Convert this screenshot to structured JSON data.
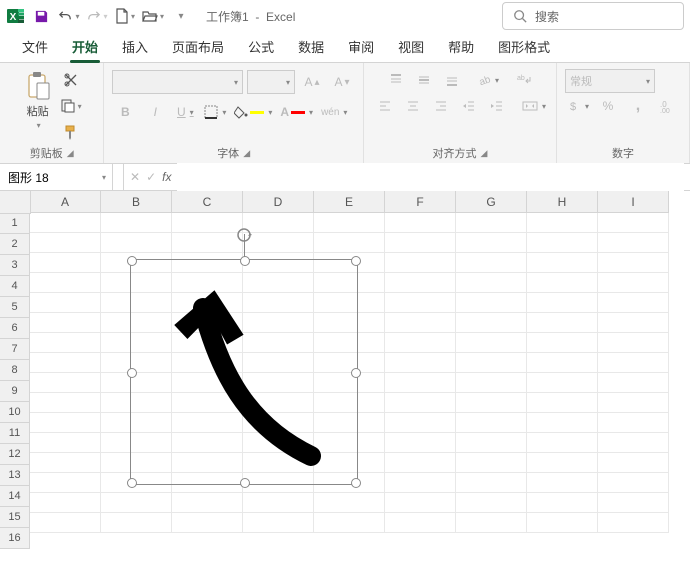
{
  "title": {
    "doc": "工作簿1",
    "app": "Excel"
  },
  "search": {
    "placeholder": "搜索"
  },
  "tabs": {
    "file": "文件",
    "home": "开始",
    "insert": "插入",
    "layout": "页面布局",
    "formulas": "公式",
    "data": "数据",
    "review": "审阅",
    "view": "视图",
    "help": "帮助",
    "shapeformat": "图形格式"
  },
  "ribbon": {
    "clipboard": {
      "label": "剪贴板",
      "paste": "粘贴"
    },
    "font": {
      "label": "字体",
      "bold": "B",
      "italic": "I",
      "underline": "U",
      "wen": "wén"
    },
    "align": {
      "label": "对齐方式"
    },
    "number": {
      "label": "数字",
      "general": "常规"
    }
  },
  "namebox": {
    "value": "图形 18"
  },
  "formula": {
    "value": ""
  },
  "cols": [
    "A",
    "B",
    "C",
    "D",
    "E",
    "F",
    "G",
    "H",
    "I"
  ],
  "rows": [
    "1",
    "2",
    "3",
    "4",
    "5",
    "6",
    "7",
    "8",
    "9",
    "10",
    "11",
    "12",
    "13",
    "14",
    "15",
    "16"
  ]
}
